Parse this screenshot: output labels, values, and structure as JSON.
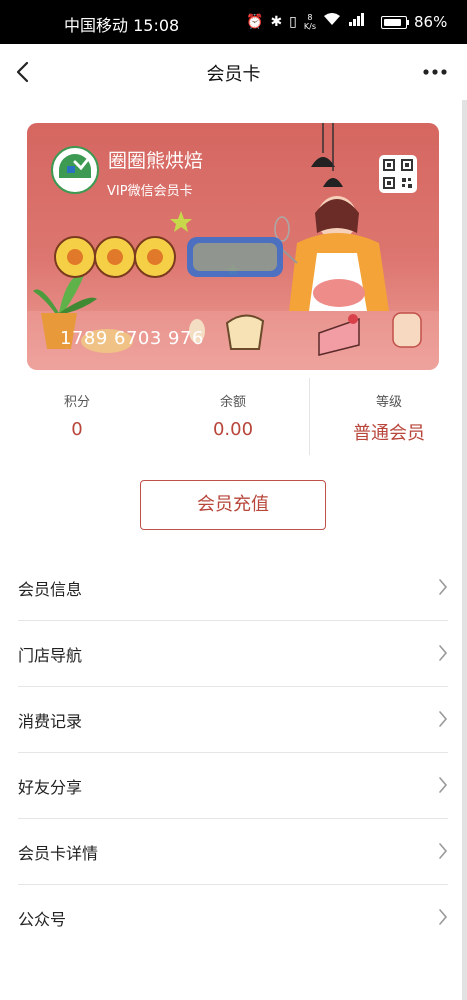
{
  "status_bar": {
    "carrier_time": "中国移动 15:08",
    "speed_value": "8",
    "speed_unit": "K/s",
    "battery_percent": "86%",
    "battery_level": 0.86
  },
  "nav": {
    "title": "会员卡"
  },
  "card": {
    "store_name": "圈圈熊烘焙",
    "card_type": "VIP微信会员卡",
    "brand_text": "圈圈熊烘焙",
    "card_number": "1789 6703 976",
    "logo_text": "圈圈熊烘焙"
  },
  "stats": [
    {
      "label": "积分",
      "value": "0"
    },
    {
      "label": "余额",
      "value": "0.00"
    },
    {
      "label": "等级",
      "value": "普通会员"
    }
  ],
  "recharge_label": "会员充值",
  "menu": [
    {
      "label": "会员信息"
    },
    {
      "label": "门店导航"
    },
    {
      "label": "消费记录"
    },
    {
      "label": "好友分享"
    },
    {
      "label": "会员卡详情"
    },
    {
      "label": "公众号"
    }
  ],
  "colors": {
    "accent": "#b8463b",
    "card_top": "#d56660",
    "card_bottom": "#ee9f99"
  }
}
